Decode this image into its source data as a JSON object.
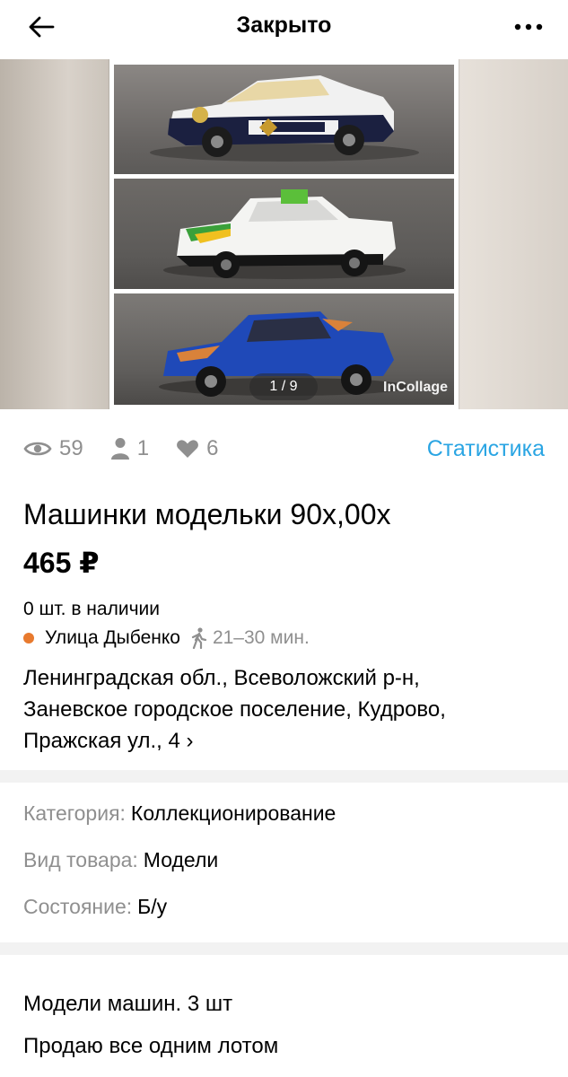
{
  "topbar": {
    "title": "Закрыто",
    "back_icon": "arrow-left-icon",
    "more_icon": "ellipsis-icon"
  },
  "gallery": {
    "counter": "1 / 9",
    "watermark": "InCollage"
  },
  "stats": {
    "views": "59",
    "favorites_users": "1",
    "likes": "6",
    "link_label": "Статистика",
    "link_color": "#2aa5e3"
  },
  "listing": {
    "title": "Машинки модельки 90х,00х",
    "price": "465 ₽",
    "stock": "0 шт. в наличии",
    "metro_station": "Улица Дыбенко",
    "metro_color": "#e87a2e",
    "walk_time": "21–30 мин.",
    "address_line1": "Ленинградская обл., Всеволожский р-н,",
    "address_line2": "Заневское городское поселение, Кудрово,",
    "address_line3": "Пражская ул., 4 ›"
  },
  "params": [
    {
      "key": "Категория:",
      "value": "Коллекционирование"
    },
    {
      "key": "Вид товара:",
      "value": "Модели"
    },
    {
      "key": "Состояние:",
      "value": "Б/у"
    }
  ],
  "description": {
    "line1": "Модели машин. 3 шт",
    "line2": "Продаю все одним лотом"
  }
}
